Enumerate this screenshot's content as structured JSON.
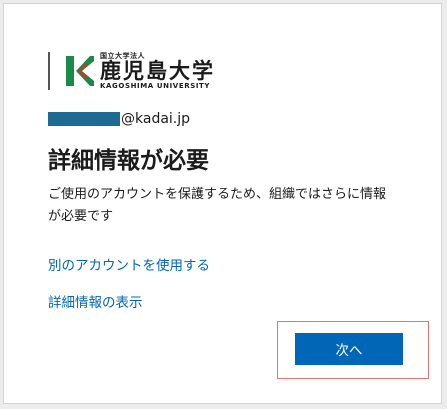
{
  "logo": {
    "top_text": "国立大学法人",
    "main_text": "鹿児島大学",
    "sub_text": "KAGOSHIMA UNIVERSITY"
  },
  "identity": {
    "email_domain": "@kadai.jp"
  },
  "title": "詳細情報が必要",
  "description": "ご使用のアカウントを保護するため、組織ではさらに情報が必要です",
  "links": {
    "use_another_account": "別のアカウントを使用する",
    "more_information": "詳細情報の表示"
  },
  "buttons": {
    "next": "次へ"
  },
  "colors": {
    "accent": "#0067b8",
    "logo_green": "#1a8a4a",
    "highlight_border": "#e57373"
  }
}
